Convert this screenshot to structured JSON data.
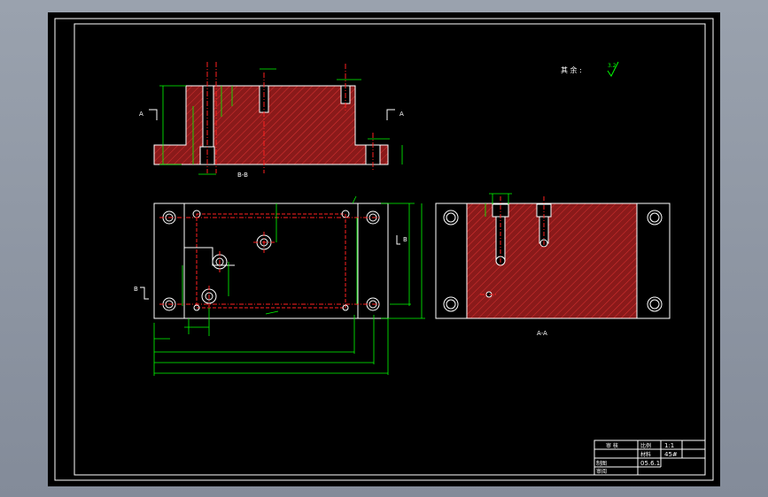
{
  "drawing": {
    "background": "#000000",
    "frame_color": "#ffffff",
    "section_color": "#8a1a1a",
    "hatch_color": "#ff3c3c",
    "dim_color": "#00ff00",
    "center_color": "#ff2020",
    "note": "其 余 :",
    "roughness": "3.2"
  },
  "labels": {
    "section_a_left": "A",
    "section_a_right": "A",
    "section_b_left": "B",
    "section_b_mark": "B",
    "view_bb": "B-B",
    "view_aa": "A-A"
  },
  "title_block": {
    "row1_a": "审 核",
    "row1_b": "比例",
    "row1_c": "1:1",
    "row2_b": "材料",
    "row2_c": "45#",
    "row3_a": "制图",
    "row3_c": "05.6.1",
    "row4_a": "审阅"
  }
}
